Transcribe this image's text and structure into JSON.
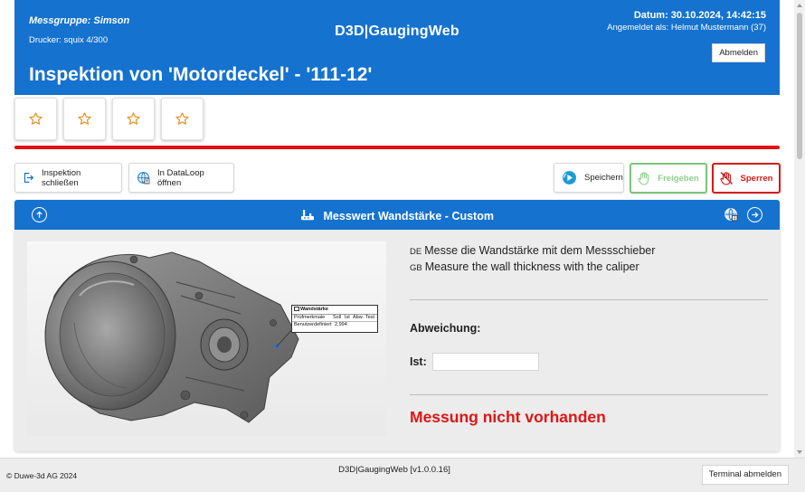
{
  "header": {
    "group": "Messgruppe: Simson",
    "printer": "Drucker: squix 4/300",
    "app_title": "D3D|GaugingWeb",
    "date": "Datum: 30.10.2024, 14:42:15",
    "user": "Angemeldet als: Helmut Mustermann (37)",
    "logout_label": "Abmelden",
    "page_title": "Inspektion von 'Motordeckel' - '111-12'",
    "color": "#1572cf"
  },
  "rating": {
    "stars": 4,
    "selected": 0,
    "star_color": "#e8952a"
  },
  "toolbar": {
    "close_label": "Inspektion schließen",
    "dataloop_label": "In DataLoop öffnen",
    "save_label": "Speichern",
    "release_label": "Freigeben",
    "lock_label": "Sperren"
  },
  "panel": {
    "title": "Messwert Wandstärke - Custom",
    "desc_de_code": "DE",
    "desc_de": "Messe die Wandstärke mit dem Messschieber",
    "desc_gb_code": "GB",
    "desc_gb": "Measure the wall thickness with the caliper",
    "deviation_label": "Abweichung:",
    "actual_label": "Ist:",
    "actual_value": "",
    "status": "Messung nicht vorhanden",
    "status_color": "#e01515"
  },
  "callout": {
    "title": "Wandstärke",
    "row1_label": "Prüfmerkmale",
    "row1_soll": "Soll",
    "row1_ist": "Ist",
    "row1_abw": "Abw.",
    "row1_test": "Test",
    "row2_label": "Benutzerdefiniert",
    "row2_value": "2,994"
  },
  "footer": {
    "copyright": "© Duwe-3d AG 2024",
    "version": "D3D|GaugingWeb [v1.0.0.16]",
    "terminal_logout": "Terminal abmelden"
  }
}
